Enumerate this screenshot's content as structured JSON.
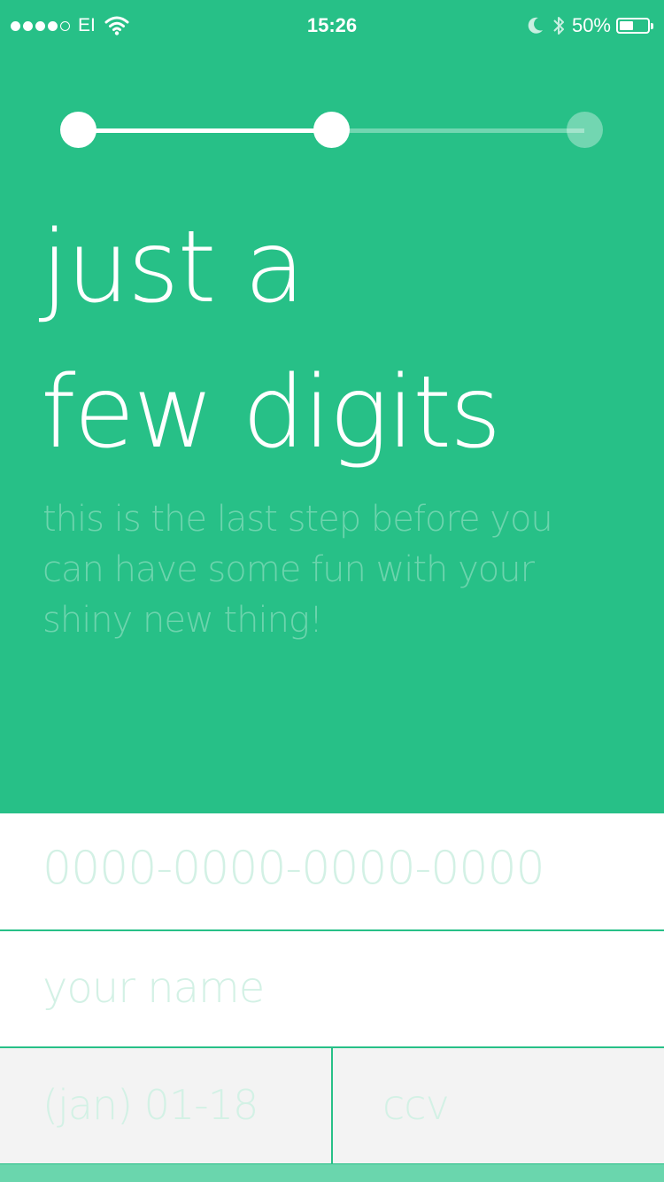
{
  "status_bar": {
    "carrier": "EI",
    "time": "15:26",
    "battery_percent": "50%",
    "battery_level": 0.5,
    "signal_dots_filled": 4,
    "signal_dots_total": 5,
    "icons": [
      "wifi-icon",
      "moon-icon",
      "bluetooth-icon",
      "battery-icon"
    ]
  },
  "stepper": {
    "total_steps": 3,
    "current_step": 2
  },
  "headline": {
    "line1": "just a",
    "line2": "few digits"
  },
  "subtitle": {
    "line1": "this is the last step before you",
    "line2": "can have some fun with your",
    "line3": "shiny new thing!"
  },
  "form": {
    "card_number_placeholder": "0000-0000-0000-0000",
    "name_placeholder": "your name",
    "expiry_placeholder": "(jan) 01-18",
    "ccv_placeholder": "ccv"
  },
  "colors": {
    "background": "#27c087",
    "text": "#ffffff",
    "placeholder": "#d3f1e5",
    "field_alt": "#f3f3f3",
    "bottom_bar": "#6ad6ad"
  }
}
